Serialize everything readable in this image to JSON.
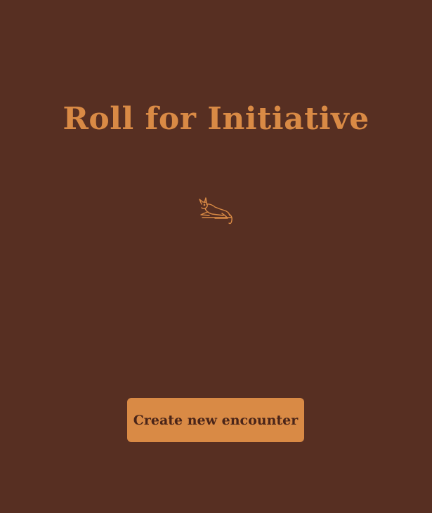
{
  "colors": {
    "background": "#572f22",
    "accent": "#d98a45",
    "button_text": "#4a2519"
  },
  "home": {
    "title": "Roll for Initiative",
    "mascot_icon": "resting-deer-icon",
    "create_button_label": "Create new encounter"
  }
}
